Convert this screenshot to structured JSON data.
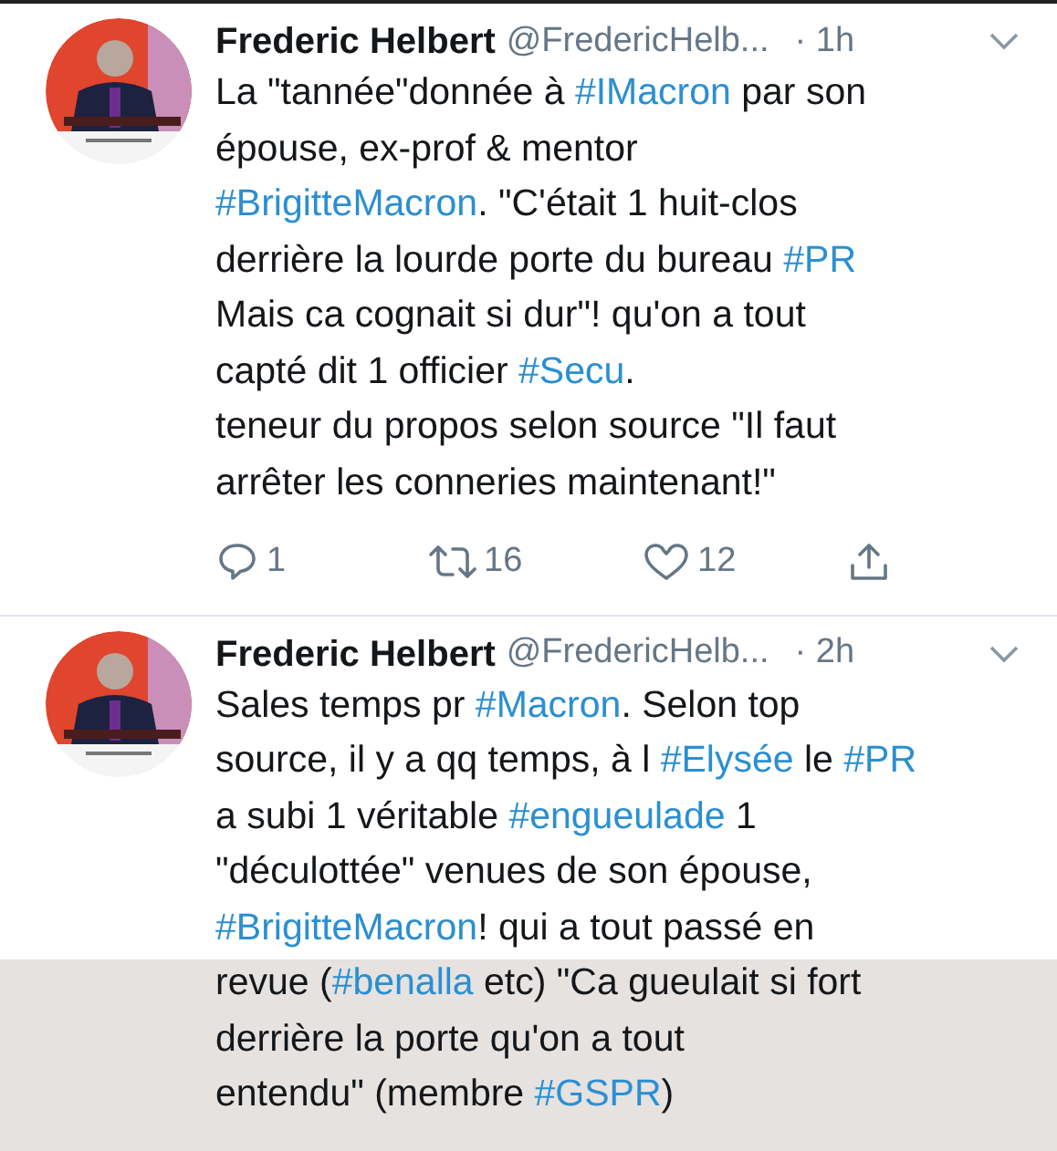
{
  "tweets": [
    {
      "name": "Frederic Helbert",
      "handle": "@FredericHelb...",
      "time": "· 1h",
      "lines": [
        "La \"tannée\"donnée à #IMacron par son",
        "épouse, ex-prof & mentor",
        "#BrigitteMacron. \"C'était 1 huit-clos",
        "derrière la lourde porte du bureau #PR",
        "Mais ca cognait si dur\"! qu'on a tout",
        "capté dit 1 officier #Secu.",
        "teneur du propos selon source \"Il faut",
        "arrêter les conneries maintenant!\""
      ],
      "actions": {
        "replies": "1",
        "retweets": "16",
        "likes": "12"
      }
    },
    {
      "name": "Frederic Helbert",
      "handle": "@FredericHelb...",
      "time": "· 2h",
      "lines": [
        "Sales temps pr #Macron. Selon top",
        "source, il y a qq temps, à l #Elysée le #PR",
        "a subi 1 véritable #engueulade 1",
        "\"déculottée\" venues de son épouse,",
        "#BrigitteMacron! qui a tout passé en",
        "revue (#benalla etc) \"Ca gueulait si fort",
        "derrière la porte qu'on a tout",
        "entendu\" (membre #GSPR)"
      ]
    }
  ],
  "overlay": true
}
